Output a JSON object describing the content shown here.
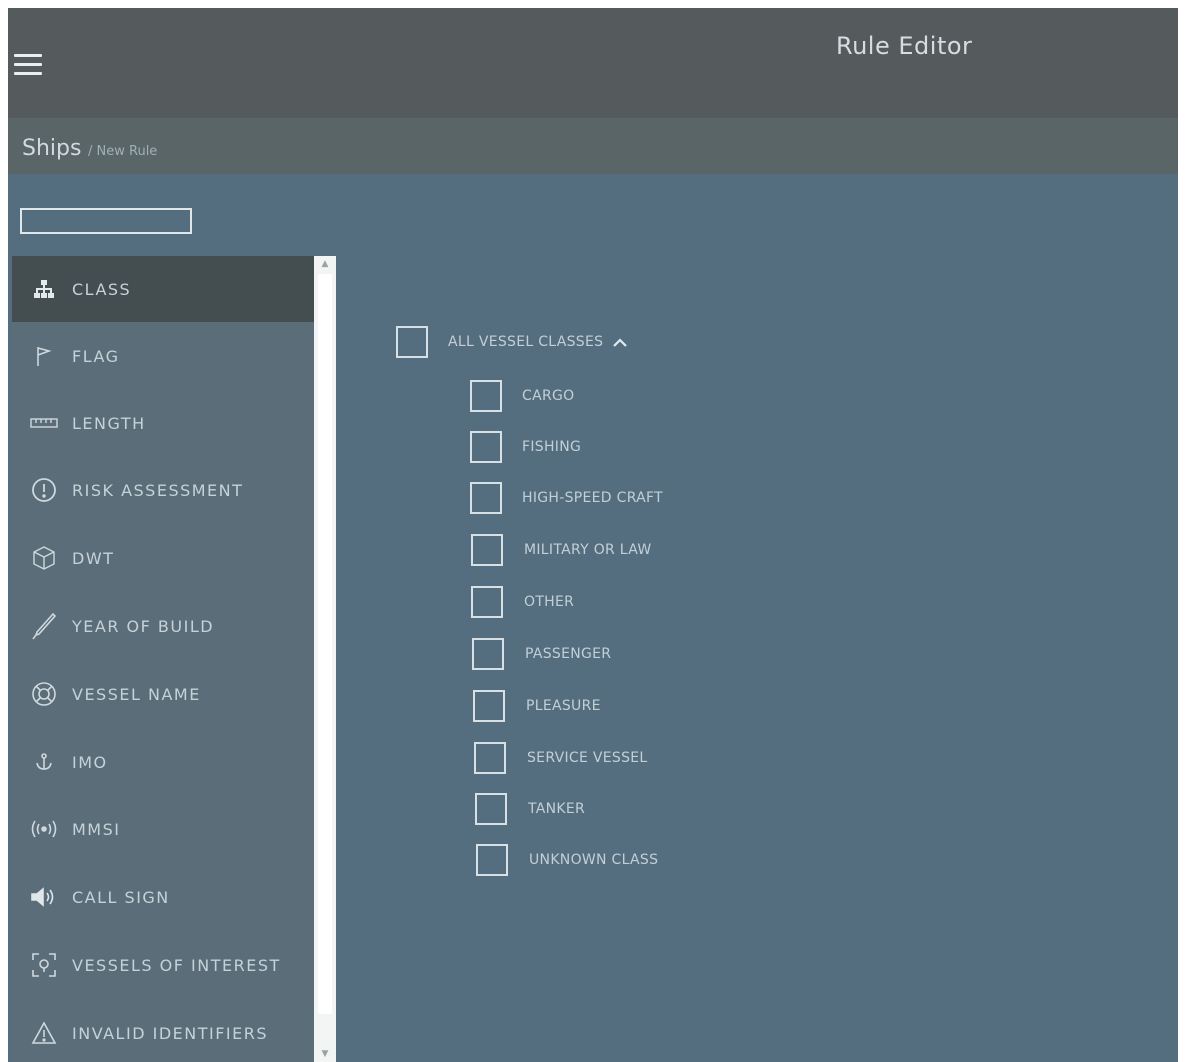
{
  "header": {
    "title": "Rule Editor",
    "menu_icon": "hamburger-menu-icon"
  },
  "breadcrumb": {
    "root": "Ships",
    "current": "/ New Rule"
  },
  "search": {
    "value": "",
    "placeholder": ""
  },
  "sidebar": {
    "active": "CLASS",
    "items": [
      {
        "label": "CLASS",
        "icon": "hierarchy-icon"
      },
      {
        "label": "FLAG",
        "icon": "flag-icon"
      },
      {
        "label": "LENGTH",
        "icon": "ruler-icon"
      },
      {
        "label": "RISK ASSESSMENT",
        "icon": "alert-circle-icon"
      },
      {
        "label": "DWT",
        "icon": "cube-icon"
      },
      {
        "label": "YEAR OF BUILD",
        "icon": "pen-icon"
      },
      {
        "label": "VESSEL NAME",
        "icon": "lifebuoy-icon"
      },
      {
        "label": "IMO",
        "icon": "anchor-icon"
      },
      {
        "label": "MMSI",
        "icon": "broadcast-icon"
      },
      {
        "label": "CALL SIGN",
        "icon": "speaker-icon"
      },
      {
        "label": "VESSELS OF INTEREST",
        "icon": "target-icon"
      },
      {
        "label": "INVALID IDENTIFIERS",
        "icon": "warning-icon"
      }
    ]
  },
  "classes": {
    "all_label": "ALL VESSEL CLASSES",
    "expanded": true,
    "items": [
      {
        "label": "CARGO",
        "checked": false
      },
      {
        "label": "FISHING",
        "checked": false
      },
      {
        "label": "HIGH-SPEED CRAFT",
        "checked": false
      },
      {
        "label": "MILITARY OR LAW",
        "checked": false
      },
      {
        "label": "OTHER",
        "checked": false
      },
      {
        "label": "PASSENGER",
        "checked": false
      },
      {
        "label": "PLEASURE",
        "checked": false
      },
      {
        "label": "SERVICE VESSEL",
        "checked": false
      },
      {
        "label": "TANKER",
        "checked": false
      },
      {
        "label": "UNKNOWN CLASS",
        "checked": false
      }
    ]
  },
  "colors": {
    "header_bg": "#555b5c",
    "content_bg": "#546e80",
    "sidebar_active_bg": "#444e51"
  }
}
